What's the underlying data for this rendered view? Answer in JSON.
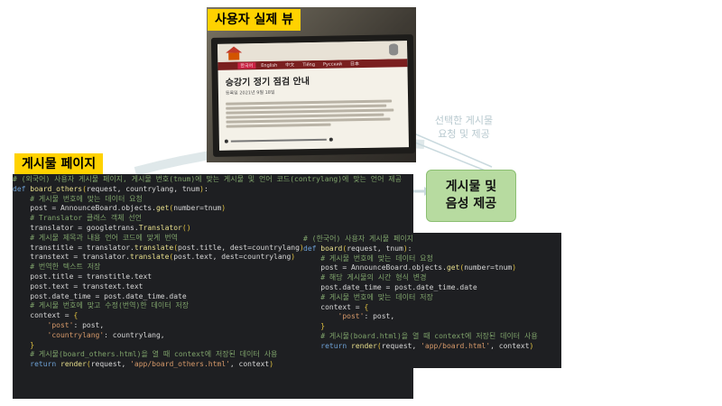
{
  "photo": {
    "label": "사용자 실제 뷰",
    "menu_items": [
      "한국어",
      "English",
      "中文",
      "Tiếng",
      "Русский",
      "日本"
    ],
    "notice_title": "승강기 정기 점검 안내",
    "notice_date": "등록일 2021년 9월 18일"
  },
  "board_label": "게시물 페이지",
  "faint_label_line1": "선택한 게시물",
  "faint_label_line2": "요청 및 제공",
  "green_box": {
    "line1": "게시물 및",
    "line2": "음성 제공"
  },
  "code_left": [
    "# (외국어) 사용자 게시물 페이지, 게시물 번호(tnum)에 맞는 게시물 및 언어 코드(contrylang)에 맞는 언어 제공",
    "def board_others(request, countrylang, tnum):",
    "    # 게시물 번호에 맞는 데이터 요청",
    "    post = AnnounceBoard.objects.get(number=tnum)",
    "    # Translator 클래스 객체 선언",
    "    translator = googletrans.Translator()",
    "    # 게시물 제목과 내용 언어 코드에 맞게 번역",
    "    transtitle = translator.translate(post.title, dest=countrylang)",
    "    transtext = translator.translate(post.text, dest=countrylang)",
    "    # 번역한 텍스트 저장",
    "    post.title = transtitle.text",
    "    post.text = transtext.text",
    "    post.date_time = post.date_time.date",
    "    # 게시물 번호에 맞고 수정(번역)한 데이터 저장",
    "    context = {",
    "        'post': post,",
    "        'countrylang': countrylang,",
    "    }",
    "    # 게시물(board_others.html)을 열 때 context에 저장된 데이터 사용",
    "    return render(request, 'app/board_others.html', context)"
  ],
  "code_right": [
    "# (한국어) 사용자 게시물 페이지",
    "def board(request, tnum):",
    "    # 게시물 번호에 맞는 데이터 요청",
    "    post = AnnounceBoard.objects.get(number=tnum)",
    "    # 해당 게시물의 시간 형식 변경",
    "    post.date_time = post.date_time.date",
    "    # 게시물 번호에 맞는 데이터 저장",
    "    context = {",
    "        'post': post,",
    "    }",
    "    # 게시물(board.html)을 열 때 context에 저장된 데이터 사용",
    "    return render(request, 'app/board.html', context)"
  ]
}
